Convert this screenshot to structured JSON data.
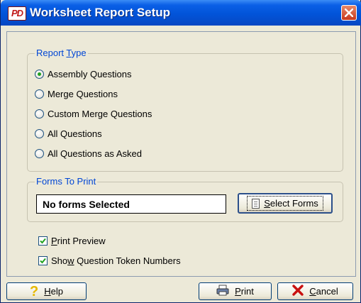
{
  "window": {
    "title": "Worksheet Report Setup",
    "app_icon_text": "PD"
  },
  "report_type": {
    "legend_prefix": "Report ",
    "legend_hotkey": "T",
    "legend_suffix": "ype",
    "options": [
      {
        "label": "Assembly Questions",
        "checked": true
      },
      {
        "label": "Merge Questions",
        "checked": false
      },
      {
        "label": "Custom Merge Questions",
        "checked": false
      },
      {
        "label": "All Questions",
        "checked": false
      },
      {
        "label": "All Questions as Asked",
        "checked": false
      }
    ]
  },
  "forms_to_print": {
    "legend": "Forms To Print",
    "value": "No forms Selected",
    "select_button": {
      "hotkey": "S",
      "rest": "elect Forms"
    }
  },
  "options": {
    "print_preview": {
      "hotkey": "P",
      "rest": "rint Preview",
      "checked": true
    },
    "show_tokens": {
      "prefix": "Sho",
      "hotkey": "w",
      "rest": " Question Token Numbers",
      "checked": true
    }
  },
  "buttons": {
    "help": {
      "hotkey": "H",
      "rest": "elp"
    },
    "print": {
      "hotkey": "P",
      "rest": "rint"
    },
    "cancel": {
      "hotkey": "C",
      "rest": "ancel"
    }
  },
  "colors": {
    "title_bar": "#0254d9",
    "group_title": "#0046d5",
    "radio_dot": "#21a121",
    "close_button": "#c8381c"
  }
}
